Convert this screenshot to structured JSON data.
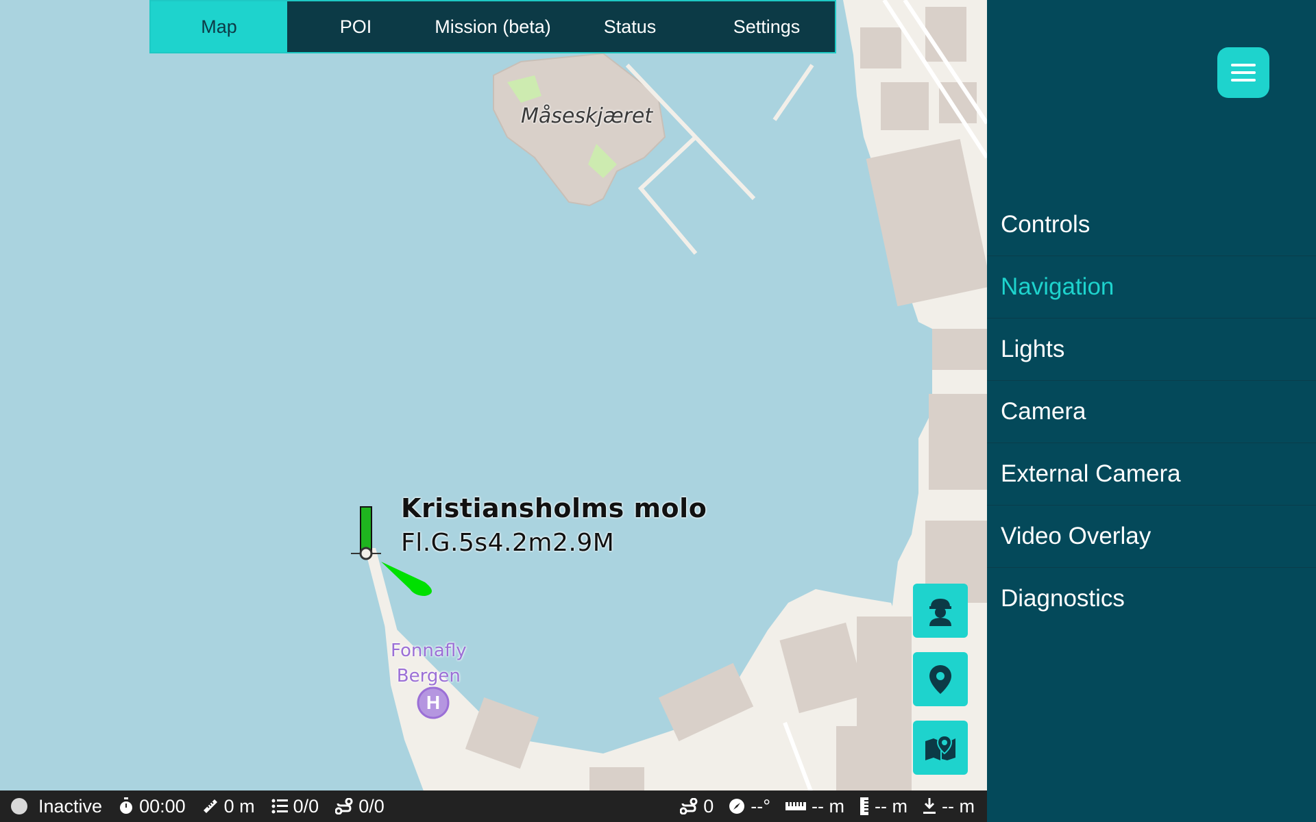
{
  "tabs": [
    {
      "label": "Map",
      "active": true
    },
    {
      "label": "POI",
      "active": false
    },
    {
      "label": "Mission (beta)",
      "active": false
    },
    {
      "label": "Status",
      "active": false
    },
    {
      "label": "Settings",
      "active": false
    }
  ],
  "sidebar": {
    "menu_icon": "hamburger-icon",
    "items": [
      {
        "label": "Controls",
        "active": false
      },
      {
        "label": "Navigation",
        "active": true
      },
      {
        "label": "Lights",
        "active": false
      },
      {
        "label": "Camera",
        "active": false
      },
      {
        "label": "External Camera",
        "active": false
      },
      {
        "label": "Video Overlay",
        "active": false
      },
      {
        "label": "Diagnostics",
        "active": false
      }
    ]
  },
  "map": {
    "island_label": "Måseskjæret",
    "light_name": "Kristiansholms molo",
    "light_characteristics": "Fl.G.5s4.2m2.9M",
    "poi_line1": "Fonnafly",
    "poi_line2": "Bergen",
    "poi_icon_letter": "H"
  },
  "floating_buttons": [
    {
      "icon": "pilot-icon"
    },
    {
      "icon": "location-pin-icon"
    },
    {
      "icon": "map-pin-icon"
    }
  ],
  "status_bar": {
    "state": "Inactive",
    "timer": "00:00",
    "distance": "0 m",
    "waypoints": "0/0",
    "route": "0/0",
    "satellites": "0",
    "heading": "--°",
    "width": "-- m",
    "height": "-- m",
    "depth": "-- m"
  },
  "colors": {
    "accent": "#1ed3cd",
    "sidebar_bg": "#04495a",
    "tab_bg": "#0c3a46",
    "water": "#aad3df",
    "land": "#f2efe9",
    "building": "#d9d0c9",
    "status_bg": "#222222"
  }
}
